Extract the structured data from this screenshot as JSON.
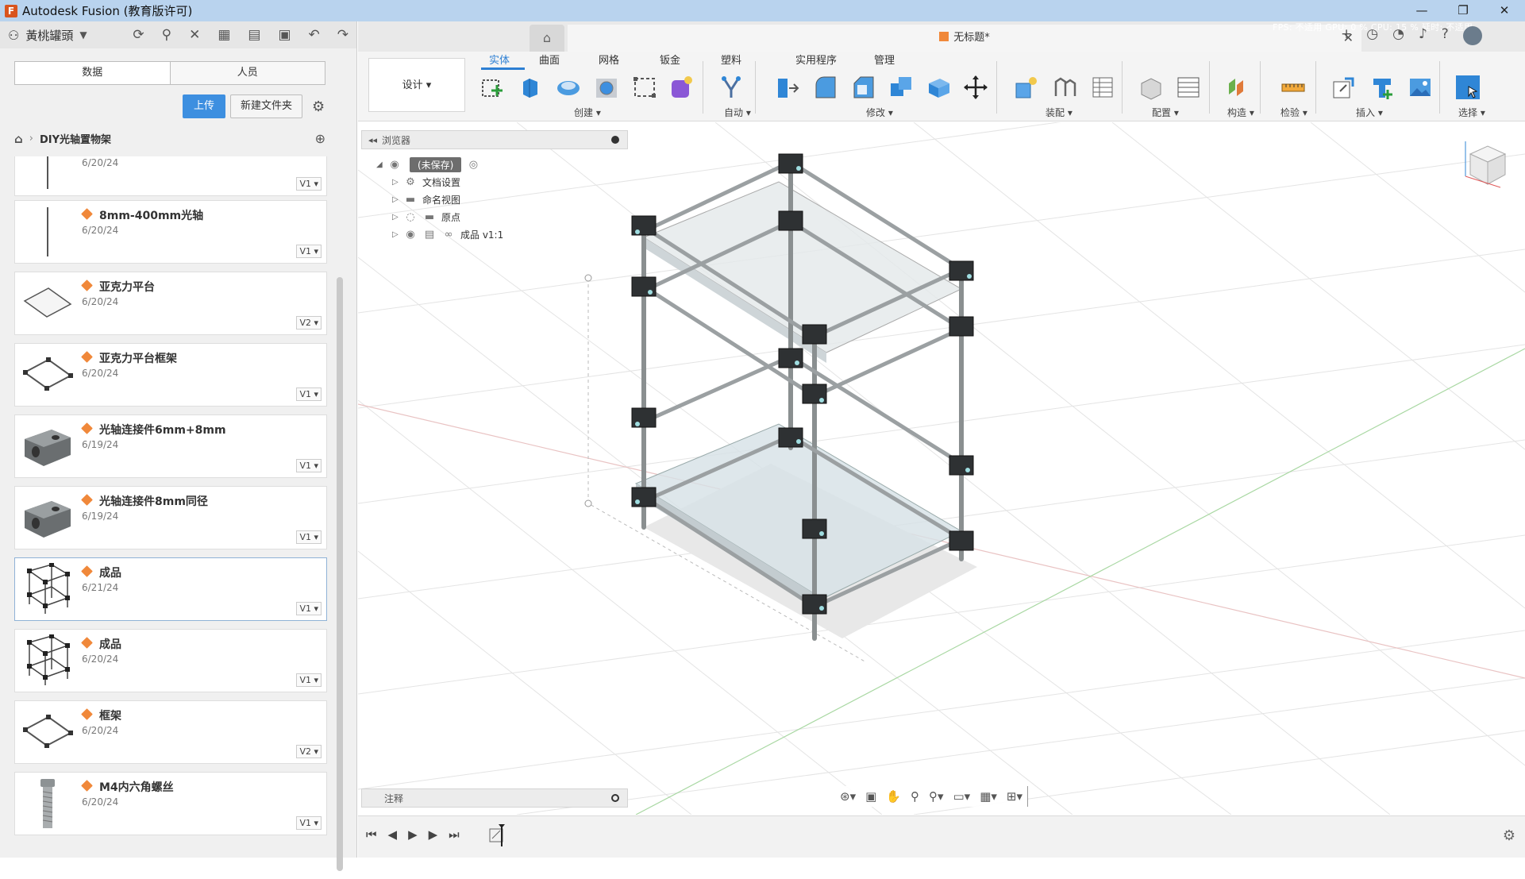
{
  "window": {
    "title": "Autodesk Fusion (教育版许可)",
    "controls": [
      "—",
      "❐",
      "✕"
    ]
  },
  "hub": {
    "name": "黃桃罐頭"
  },
  "data_panel": {
    "tabs": [
      "数据",
      "人员"
    ],
    "upload_label": "上传",
    "new_folder_label": "新建文件夹",
    "breadcrumb": "DIY光轴置物架",
    "files": [
      {
        "name": "",
        "date": "6/20/24",
        "version": "V1 ▾",
        "thumb": "rod"
      },
      {
        "name": "8mm-400mm光轴",
        "date": "6/20/24",
        "version": "V1 ▾",
        "thumb": "rod"
      },
      {
        "name": "亚克力平台",
        "date": "6/20/24",
        "version": "V2 ▾",
        "thumb": "plate"
      },
      {
        "name": "亚克力平台框架",
        "date": "6/20/24",
        "version": "V1 ▾",
        "thumb": "frame"
      },
      {
        "name": "光轴连接件6mm+8mm",
        "date": "6/19/24",
        "version": "V1 ▾",
        "thumb": "block"
      },
      {
        "name": "光轴连接件8mm同径",
        "date": "6/19/24",
        "version": "V1 ▾",
        "thumb": "block"
      },
      {
        "name": "成品",
        "date": "6/21/24",
        "version": "V1 ▾",
        "thumb": "shelf",
        "selected": true
      },
      {
        "name": "成品",
        "date": "6/20/24",
        "version": "V1 ▾",
        "thumb": "shelf"
      },
      {
        "name": "框架",
        "date": "6/20/24",
        "version": "V2 ▾",
        "thumb": "frame"
      },
      {
        "name": "M4内六角螺丝",
        "date": "6/20/24",
        "version": "V1 ▾",
        "thumb": "screw"
      }
    ]
  },
  "document": {
    "tab_title": "无标题*",
    "perf": "FPS: 不适用 GPU: 0 % CPU: 15 % 延时: 不适用"
  },
  "toolbar": {
    "workspace": "设计 ▾",
    "tabs": [
      "实体",
      "曲面",
      "网格",
      "钣金",
      "塑料",
      "实用程序",
      "管理"
    ],
    "active_tab": "实体",
    "groups": [
      "创建 ▾",
      "自动 ▾",
      "修改 ▾",
      "装配 ▾",
      "配置 ▾",
      "构造 ▾",
      "检验 ▾",
      "插入 ▾",
      "选择 ▾"
    ]
  },
  "browser": {
    "title": "浏览器",
    "root": "(未保存)",
    "items": [
      "文档设置",
      "命名视图",
      "原点",
      "成品 v1:1"
    ]
  },
  "notes": {
    "title": "注释"
  },
  "colors": {
    "accent": "#2d7fd3",
    "upload": "#3d8fe0",
    "titlebar": "#b9d3ee",
    "file_icon": "#f0883a"
  },
  "icons": {
    "hub": "people-icon",
    "home": "home-icon",
    "settings": "gear-icon"
  }
}
